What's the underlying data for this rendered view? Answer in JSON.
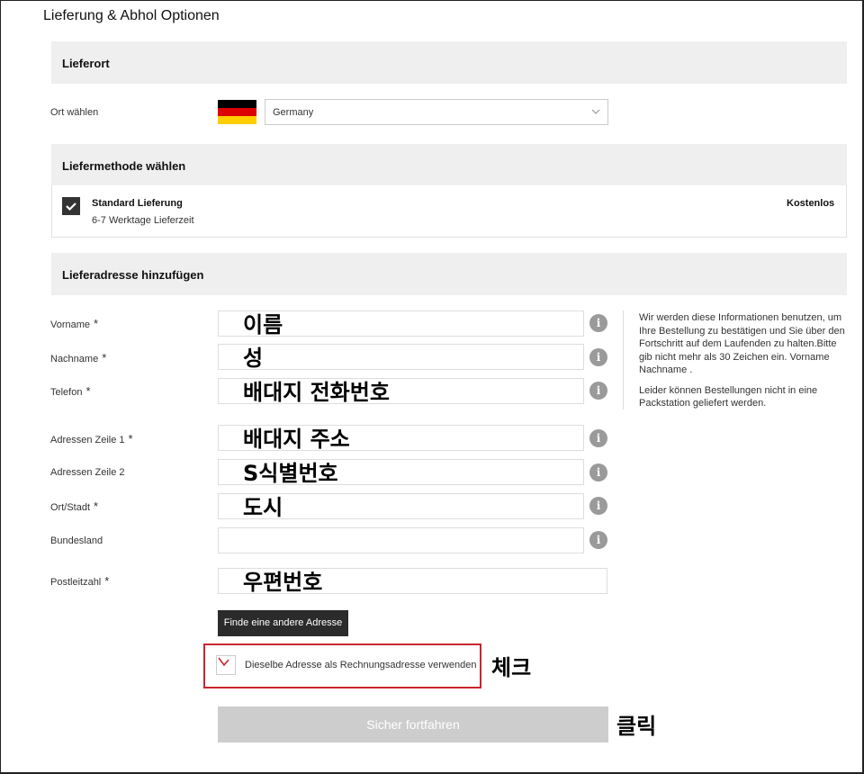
{
  "page": {
    "title": "Lieferung & Abhol Optionen"
  },
  "location": {
    "section_title": "Lieferort",
    "label": "Ort wählen",
    "flag_icon": "germany-flag-icon",
    "flag_colors": [
      "#000000",
      "#dd0000",
      "#ffce00"
    ],
    "country": "Germany"
  },
  "method": {
    "section_title": "Liefermethode wählen",
    "name": "Standard Lieferung",
    "time": "6-7 Werktage Lieferzeit",
    "price": "Kostenlos",
    "checked": true
  },
  "address": {
    "section_title": "Lieferadresse hinzufügen",
    "required_mark": "*",
    "fields": {
      "first_name": {
        "label": "Vorname",
        "value": "이름"
      },
      "last_name": {
        "label": "Nachname",
        "value": "성"
      },
      "phone": {
        "label": "Telefon",
        "value": "배대지 전화번호"
      },
      "line1": {
        "label": "Adressen Zeile 1",
        "value": "배대지 주소"
      },
      "line2": {
        "label": "Adressen Zeile 2",
        "value": "S식별번호"
      },
      "city": {
        "label": "Ort/Stadt",
        "value": "도시"
      },
      "state": {
        "label": "Bundesland",
        "value": ""
      },
      "postal": {
        "label": "Postleitzahl",
        "value": "우편번호"
      }
    },
    "info_text_1": "Wir werden diese Informationen benutzen, um Ihre Bestellung zu bestätigen und Sie über den Fortschritt auf dem Laufenden zu halten.Bitte gib nicht mehr als 30 Zeichen ein. Vorname Nachname .",
    "info_text_2": "Leider können Bestellungen nicht in eine Packstation geliefert werden.",
    "find_button": "Finde eine andere Adresse",
    "same_billing_label": "Dieselbe Adresse als Rechnungsadresse verwenden",
    "submit_button": "Sicher fortfahren"
  },
  "annotations": {
    "check": "체크",
    "click": "클릭"
  },
  "colors": {
    "band": "#efefef",
    "highlight_box": "#c9262c",
    "disabled_button": "#cdcdcd",
    "dark_button": "#2b2b2b"
  }
}
